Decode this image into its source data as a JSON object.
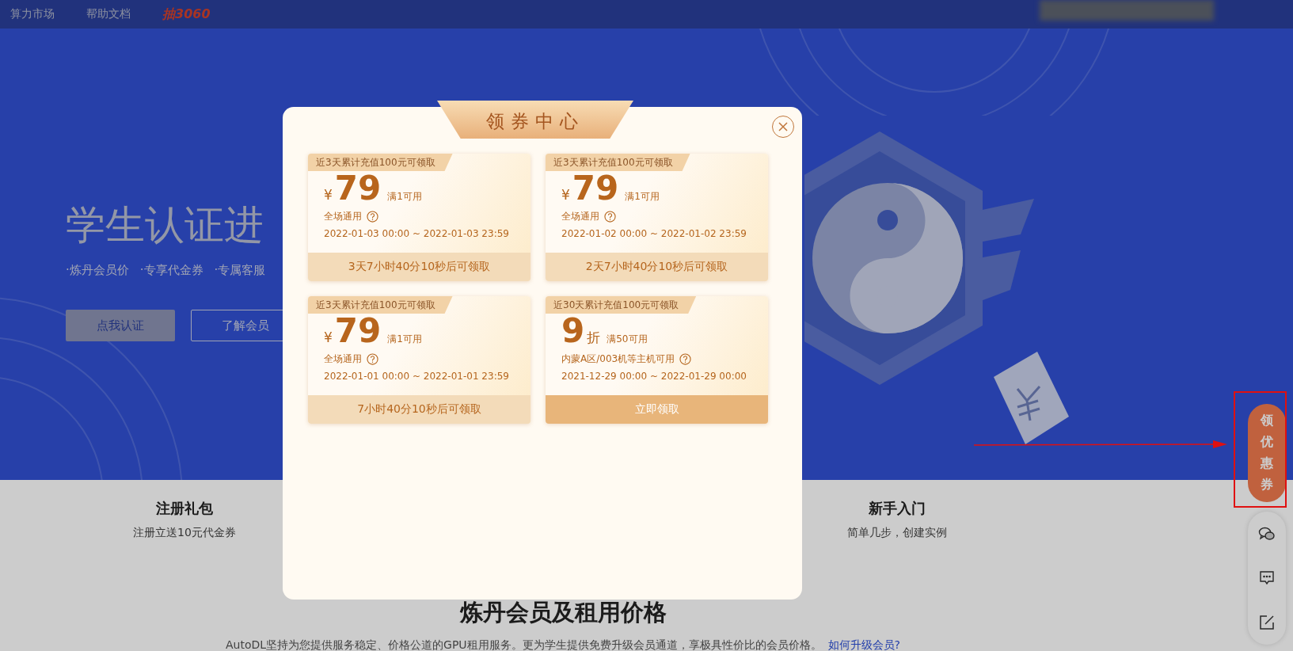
{
  "nav": [
    {
      "label": "算力市场",
      "kind": "link"
    },
    {
      "label": "帮助文档",
      "kind": "link"
    },
    {
      "label": "抽3060",
      "kind": "promo"
    }
  ],
  "hero": {
    "title": "学生认证进",
    "bullets": [
      "·炼丹会员价",
      "·专享代金券",
      "·专属客服"
    ],
    "buttons": [
      {
        "label": "点我认证",
        "kind": "primary"
      },
      {
        "label": "了解会员",
        "kind": "outline"
      }
    ]
  },
  "features": [
    {
      "title": "注册礼包",
      "subtitle": "注册立送10元代金券"
    },
    {
      "title": "新手入门",
      "subtitle": "简单几步，创建实例"
    }
  ],
  "pricing": {
    "title": "炼丹会员及租用价格",
    "description": "AutoDL坚持为您提供服务稳定、价格公道的GPU租用服务。更为学生提供免费升级会员通道，享极具性价比的会员价格。",
    "link": "如何升级会员?"
  },
  "coupon_badge": {
    "label": "领优惠券"
  },
  "modal": {
    "title": "领券中心",
    "coupons": [
      {
        "kind": "amount",
        "tag": "近3天累计充值100元可领取",
        "currency": "¥",
        "value": "79",
        "condition": "满1可用",
        "scope": "全场通用",
        "period": "2022-01-03 00:00 ~ 2022-01-03 23:59",
        "action": "3天7小时40分10秒后可领取",
        "claimable": false
      },
      {
        "kind": "amount",
        "tag": "近3天累计充值100元可领取",
        "currency": "¥",
        "value": "79",
        "condition": "满1可用",
        "scope": "全场通用",
        "period": "2022-01-02 00:00 ~ 2022-01-02 23:59",
        "action": "2天7小时40分10秒后可领取",
        "claimable": false
      },
      {
        "kind": "amount",
        "tag": "近3天累计充值100元可领取",
        "currency": "¥",
        "value": "79",
        "condition": "满1可用",
        "scope": "全场通用",
        "period": "2022-01-01 00:00 ~ 2022-01-01 23:59",
        "action": "7小时40分10秒后可领取",
        "claimable": false
      },
      {
        "kind": "discount",
        "tag": "近30天累计充值100元可领取",
        "value": "9",
        "unit": "折",
        "condition": "满50可用",
        "scope": "内蒙A区/003机等主机可用",
        "period": "2021-12-29 00:00 ~ 2022-01-29 00:00",
        "action": "立即领取",
        "claimable": true
      }
    ]
  }
}
